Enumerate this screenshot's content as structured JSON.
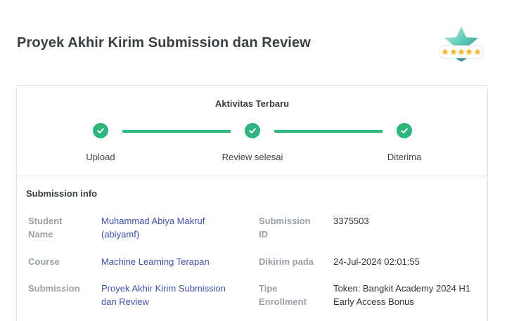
{
  "header": {
    "title": "Proyek Akhir Kirim Submission dan Review",
    "badge_icon": "star-rating-badge-icon"
  },
  "colors": {
    "accent": "#2db67c",
    "link": "#3f51b5",
    "label": "#9aa0a6"
  },
  "activity": {
    "title": "Aktivitas Terbaru",
    "steps": [
      {
        "label": "Upload",
        "icon": "check-icon",
        "done": true
      },
      {
        "label": "Review selesai",
        "icon": "check-icon",
        "done": true
      },
      {
        "label": "Diterima",
        "icon": "check-icon",
        "done": true
      }
    ]
  },
  "submission_info": {
    "title": "Submission info",
    "student_name_label_1": "Student",
    "student_name_label_2": "Name",
    "student_name_1": "Muhammad Abiya Makruf",
    "student_name_2": "(abiyamf)",
    "submission_id_label_1": "Submission",
    "submission_id_label_2": "ID",
    "submission_id": "3375503",
    "course_label": "Course",
    "course": "Machine Learning Terapan",
    "sent_label": "Dikirim pada",
    "sent_at": "24-Jul-2024 02:01:55",
    "submission_label": "Submission",
    "submission_1": "Proyek Akhir Kirim Submission",
    "submission_2": "dan Review",
    "enrollment_label_1": "Tipe",
    "enrollment_label_2": "Enrollment",
    "enrollment_1": "Token: Bangkit Academy 2024 H1",
    "enrollment_2": "Early Access Bonus"
  }
}
